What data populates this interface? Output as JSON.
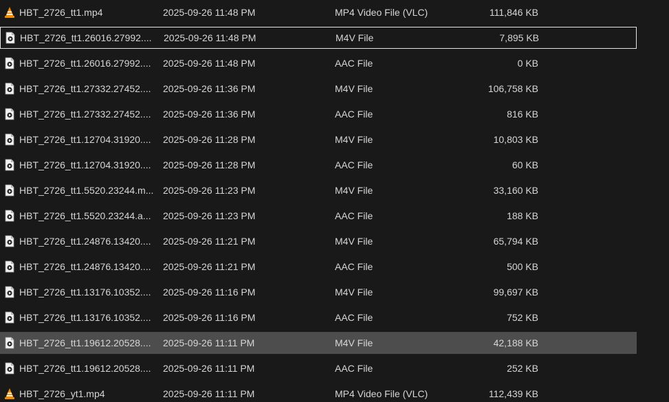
{
  "files": [
    {
      "name": "HBT_2726_tt1.mp4",
      "date": "2025-09-26 11:48 PM",
      "type": "MP4 Video File (VLC)",
      "size": "111,846 KB",
      "icon": "vlc-icon"
    },
    {
      "name": "HBT_2726_tt1.26016.27992....",
      "date": "2025-09-26 11:48 PM",
      "type": "M4V File",
      "size": "7,895 KB",
      "icon": "media-file-icon"
    },
    {
      "name": "HBT_2726_tt1.26016.27992....",
      "date": "2025-09-26 11:48 PM",
      "type": "AAC File",
      "size": "0 KB",
      "icon": "media-file-icon"
    },
    {
      "name": "HBT_2726_tt1.27332.27452....",
      "date": "2025-09-26 11:36 PM",
      "type": "M4V File",
      "size": "106,758 KB",
      "icon": "media-file-icon"
    },
    {
      "name": "HBT_2726_tt1.27332.27452....",
      "date": "2025-09-26 11:36 PM",
      "type": "AAC File",
      "size": "816 KB",
      "icon": "media-file-icon"
    },
    {
      "name": "HBT_2726_tt1.12704.31920....",
      "date": "2025-09-26 11:28 PM",
      "type": "M4V File",
      "size": "10,803 KB",
      "icon": "media-file-icon"
    },
    {
      "name": "HBT_2726_tt1.12704.31920....",
      "date": "2025-09-26 11:28 PM",
      "type": "AAC File",
      "size": "60 KB",
      "icon": "media-file-icon"
    },
    {
      "name": "HBT_2726_tt1.5520.23244.m...",
      "date": "2025-09-26 11:23 PM",
      "type": "M4V File",
      "size": "33,160 KB",
      "icon": "media-file-icon"
    },
    {
      "name": "HBT_2726_tt1.5520.23244.a...",
      "date": "2025-09-26 11:23 PM",
      "type": "AAC File",
      "size": "188 KB",
      "icon": "media-file-icon"
    },
    {
      "name": "HBT_2726_tt1.24876.13420....",
      "date": "2025-09-26 11:21 PM",
      "type": "M4V File",
      "size": "65,794 KB",
      "icon": "media-file-icon"
    },
    {
      "name": "HBT_2726_tt1.24876.13420....",
      "date": "2025-09-26 11:21 PM",
      "type": "AAC File",
      "size": "500 KB",
      "icon": "media-file-icon"
    },
    {
      "name": "HBT_2726_tt1.13176.10352....",
      "date": "2025-09-26 11:16 PM",
      "type": "M4V File",
      "size": "99,697 KB",
      "icon": "media-file-icon"
    },
    {
      "name": "HBT_2726_tt1.13176.10352....",
      "date": "2025-09-26 11:16 PM",
      "type": "AAC File",
      "size": "752 KB",
      "icon": "media-file-icon"
    },
    {
      "name": "HBT_2726_tt1.19612.20528....",
      "date": "2025-09-26 11:11 PM",
      "type": "M4V File",
      "size": "42,188 KB",
      "icon": "media-file-icon"
    },
    {
      "name": "HBT_2726_tt1.19612.20528....",
      "date": "2025-09-26 11:11 PM",
      "type": "AAC File",
      "size": "252 KB",
      "icon": "media-file-icon"
    },
    {
      "name": "HBT_2726_yt1.mp4",
      "date": "2025-09-26 11:11 PM",
      "type": "MP4 Video File (VLC)",
      "size": "112,439 KB",
      "icon": "vlc-icon"
    }
  ],
  "focused_index": 1,
  "selected_index": 13,
  "colors": {
    "background": "#191919",
    "text": "#d6d6d6",
    "selected_row": "#4d4d4d",
    "focus_border": "#e6e6e6",
    "vlc_orange": "#f08a00"
  }
}
